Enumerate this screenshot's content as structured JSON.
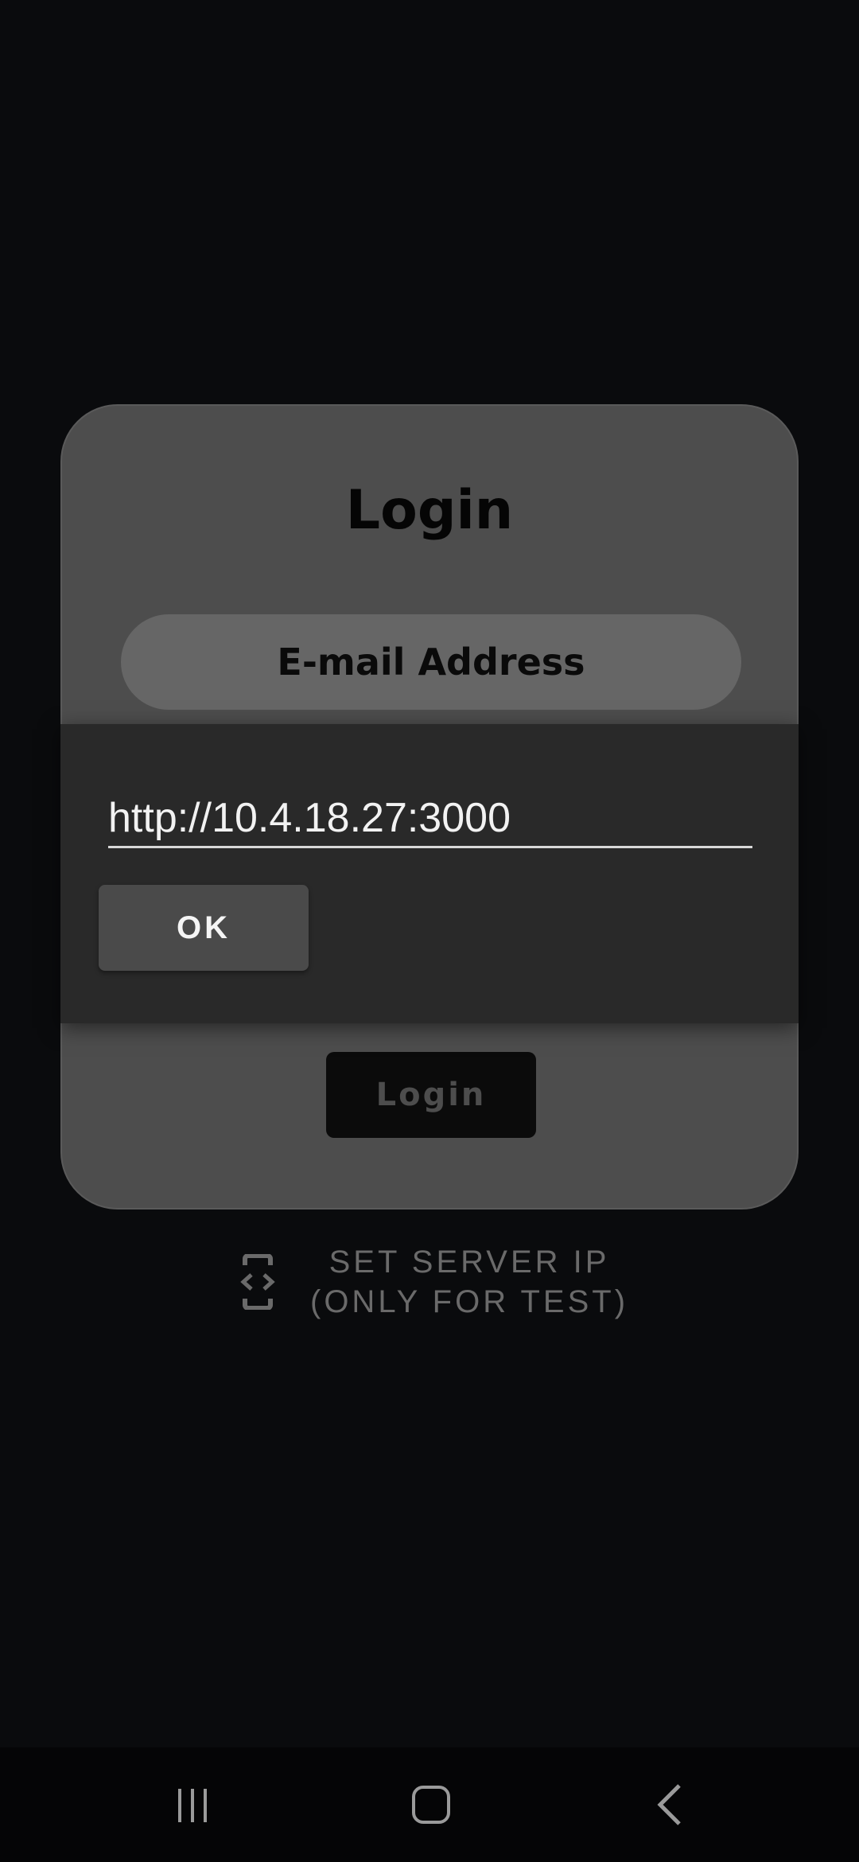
{
  "login": {
    "title": "Login",
    "email_placeholder": "E-mail Address",
    "login_button": "Login"
  },
  "dialog": {
    "ip_value": "http://10.4.18.27:3000",
    "ok_label": "OK"
  },
  "server_link": {
    "line1": "SET SERVER IP",
    "line2": "(ONLY FOR TEST)",
    "icon": "developer-mode-icon"
  },
  "nav": {
    "recents_icon": "recents-icon",
    "home_icon": "home-icon",
    "back_icon": "back-icon"
  },
  "colors": {
    "background": "#0a0b0d",
    "card": "#4d4d4d",
    "dialog": "#292929",
    "muted_text": "#6a6a6a"
  }
}
